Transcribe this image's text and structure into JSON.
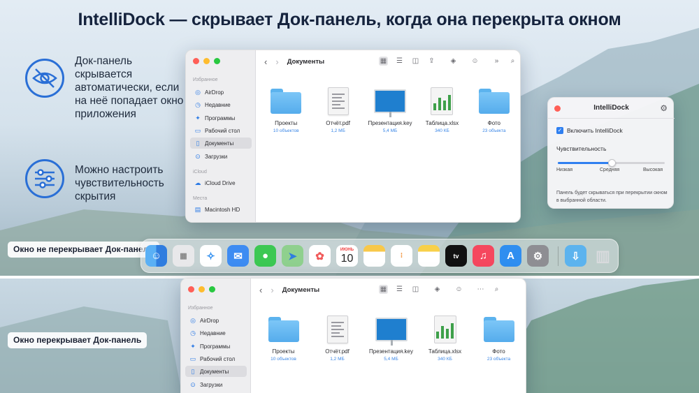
{
  "headline": "IntelliDock — скрывает Док-панель, когда она перекрыта окном",
  "features": [
    {
      "icon": "eye-slash-icon",
      "text": "Док-панель скрывается автоматически, если на неё попадает окно приложения"
    },
    {
      "icon": "sliders-icon",
      "text": "Можно настроить чувствительность скрытия"
    }
  ],
  "finder": {
    "title": "Документы",
    "sections": {
      "favorites": "Избранное",
      "icloud": "iCloud",
      "places": "Места"
    },
    "sidebar_items": [
      {
        "label": "AirDrop",
        "icon": "airdrop-icon"
      },
      {
        "label": "Недавние",
        "icon": "clock-icon"
      },
      {
        "label": "Программы",
        "icon": "apps-icon"
      },
      {
        "label": "Рабочий стол",
        "icon": "desktop-icon"
      },
      {
        "label": "Документы",
        "icon": "document-icon"
      },
      {
        "label": "Загрузки",
        "icon": "download-icon"
      }
    ],
    "icloud_items": [
      {
        "label": "iCloud Drive",
        "icon": "cloud-icon"
      }
    ],
    "places_items": [
      {
        "label": "Macintosh HD",
        "icon": "disk-icon"
      }
    ],
    "files": [
      {
        "name": "Проекты",
        "meta": "10 объектов",
        "type": "folder"
      },
      {
        "name": "Отчёт.pdf",
        "meta": "1,2 МБ",
        "type": "pdf"
      },
      {
        "name": "Презентация.key",
        "meta": "5,4 МБ",
        "type": "key"
      },
      {
        "name": "Таблица.xlsx",
        "meta": "340 КБ",
        "type": "xlsx"
      },
      {
        "name": "Фото",
        "meta": "23 объекта",
        "type": "folder"
      }
    ]
  },
  "settings": {
    "title": "IntelliDock",
    "enable_label": "Включить IntelliDock",
    "enabled": true,
    "sensitivity_label": "Чувствительность",
    "sensitivity_levels": [
      "Низкая",
      "Средняя",
      "Высокая"
    ],
    "sensitivity_value": 0.5,
    "note": "Панель будет скрываться при перекрытии окном в выбранной области."
  },
  "badges": {
    "not_overlapping": "Окно не перекрывает Док-панель",
    "overlapping": "Окно перекрывает Док-панель"
  },
  "dock": {
    "apps": [
      "finder-icon",
      "launchpad-icon",
      "safari-icon",
      "mail-icon",
      "messages-icon",
      "maps-icon",
      "photos-icon",
      "calendar-icon",
      "notes-icon",
      "reminders-icon",
      "notes-yellow-icon",
      "appletv-icon",
      "music-icon",
      "appstore-icon",
      "system-settings-icon",
      "downloads-folder-icon",
      "trash-icon"
    ],
    "calendar_month": "ИЮНЬ",
    "calendar_day": "10"
  }
}
